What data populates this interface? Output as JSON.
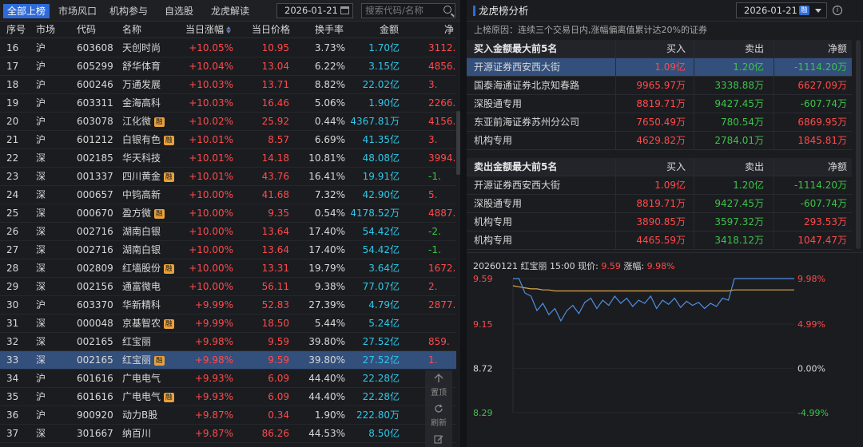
{
  "tabs": [
    "全部上榜",
    "市场风口",
    "机构参与",
    "自选股",
    "龙虎解读"
  ],
  "left_date": "2026-01-21",
  "search_placeholder": "搜索代码/名称",
  "columns": [
    "序号",
    "市场",
    "代码",
    "名称",
    "当日涨幅",
    "当日价格",
    "换手率",
    "金额",
    "净"
  ],
  "rows": [
    {
      "seq": "16",
      "mkt": "沪",
      "code": "603608",
      "name": "天创时尚",
      "rz": false,
      "chg": "+10.05%",
      "price": "10.95",
      "turn": "3.73%",
      "amt": "1.70亿",
      "net": "3112.",
      "neg": false
    },
    {
      "seq": "17",
      "mkt": "沪",
      "code": "605299",
      "name": "舒华体育",
      "rz": false,
      "chg": "+10.04%",
      "price": "13.04",
      "turn": "6.22%",
      "amt": "3.15亿",
      "net": "4856.",
      "neg": false
    },
    {
      "seq": "18",
      "mkt": "沪",
      "code": "600246",
      "name": "万通发展",
      "rz": false,
      "chg": "+10.03%",
      "price": "13.71",
      "turn": "8.82%",
      "amt": "22.02亿",
      "net": "3.",
      "neg": false
    },
    {
      "seq": "19",
      "mkt": "沪",
      "code": "603311",
      "name": "金海高科",
      "rz": false,
      "chg": "+10.03%",
      "price": "16.46",
      "turn": "5.06%",
      "amt": "1.90亿",
      "net": "2266.",
      "neg": false
    },
    {
      "seq": "20",
      "mkt": "沪",
      "code": "603078",
      "name": "江化微",
      "rz": true,
      "chg": "+10.02%",
      "price": "25.92",
      "turn": "0.44%",
      "amt": "4367.81万",
      "net": "4156.",
      "neg": false
    },
    {
      "seq": "21",
      "mkt": "沪",
      "code": "601212",
      "name": "白银有色",
      "rz": true,
      "chg": "+10.01%",
      "price": "8.57",
      "turn": "6.69%",
      "amt": "41.35亿",
      "net": "3.",
      "neg": false
    },
    {
      "seq": "22",
      "mkt": "深",
      "code": "002185",
      "name": "华天科技",
      "rz": false,
      "chg": "+10.01%",
      "price": "14.18",
      "turn": "10.81%",
      "amt": "48.08亿",
      "net": "3994.",
      "neg": false
    },
    {
      "seq": "23",
      "mkt": "深",
      "code": "001337",
      "name": "四川黄金",
      "rz": true,
      "chg": "+10.01%",
      "price": "43.76",
      "turn": "16.41%",
      "amt": "19.91亿",
      "net": "-1.",
      "neg": true
    },
    {
      "seq": "24",
      "mkt": "深",
      "code": "000657",
      "name": "中钨高新",
      "rz": false,
      "chg": "+10.00%",
      "price": "41.68",
      "turn": "7.32%",
      "amt": "42.90亿",
      "net": "5.",
      "neg": false
    },
    {
      "seq": "25",
      "mkt": "深",
      "code": "000670",
      "name": "盈方微",
      "rz": true,
      "chg": "+10.00%",
      "price": "9.35",
      "turn": "0.54%",
      "amt": "4178.52万",
      "net": "4887.",
      "neg": false
    },
    {
      "seq": "26",
      "mkt": "深",
      "code": "002716",
      "name": "湖南白银",
      "rz": false,
      "chg": "+10.00%",
      "price": "13.64",
      "turn": "17.40%",
      "amt": "54.42亿",
      "net": "-2.",
      "neg": true
    },
    {
      "seq": "27",
      "mkt": "深",
      "code": "002716",
      "name": "湖南白银",
      "rz": false,
      "chg": "+10.00%",
      "price": "13.64",
      "turn": "17.40%",
      "amt": "54.42亿",
      "net": "-1.",
      "neg": true
    },
    {
      "seq": "28",
      "mkt": "深",
      "code": "002809",
      "name": "红墙股份",
      "rz": true,
      "chg": "+10.00%",
      "price": "13.31",
      "turn": "19.79%",
      "amt": "3.64亿",
      "net": "1672.",
      "neg": false
    },
    {
      "seq": "29",
      "mkt": "深",
      "code": "002156",
      "name": "通富微电",
      "rz": false,
      "chg": "+10.00%",
      "price": "56.11",
      "turn": "9.38%",
      "amt": "77.07亿",
      "net": "2.",
      "neg": false
    },
    {
      "seq": "30",
      "mkt": "沪",
      "code": "603370",
      "name": "华新精科",
      "rz": false,
      "chg": "+9.99%",
      "price": "52.83",
      "turn": "27.39%",
      "amt": "4.79亿",
      "net": "2877.",
      "neg": false
    },
    {
      "seq": "31",
      "mkt": "深",
      "code": "000048",
      "name": "京基智农",
      "rz": true,
      "chg": "+9.99%",
      "price": "18.50",
      "turn": "5.44%",
      "amt": "5.24亿",
      "net": "",
      "neg": false
    },
    {
      "seq": "32",
      "mkt": "深",
      "code": "002165",
      "name": "红宝丽",
      "rz": false,
      "chg": "+9.98%",
      "price": "9.59",
      "turn": "39.80%",
      "amt": "27.52亿",
      "net": "859.",
      "neg": false
    },
    {
      "seq": "33",
      "mkt": "深",
      "code": "002165",
      "name": "红宝丽",
      "rz": true,
      "chg": "+9.98%",
      "price": "9.59",
      "turn": "39.80%",
      "amt": "27.52亿",
      "net": "1.",
      "neg": false
    },
    {
      "seq": "34",
      "mkt": "沪",
      "code": "601616",
      "name": "广电电气",
      "rz": false,
      "chg": "+9.93%",
      "price": "6.09",
      "turn": "44.40%",
      "amt": "22.28亿",
      "net": "",
      "neg": false
    },
    {
      "seq": "35",
      "mkt": "沪",
      "code": "601616",
      "name": "广电电气",
      "rz": true,
      "chg": "+9.93%",
      "price": "6.09",
      "turn": "44.40%",
      "amt": "22.28亿",
      "net": "",
      "neg": false
    },
    {
      "seq": "36",
      "mkt": "沪",
      "code": "900920",
      "name": "动力B股",
      "rz": false,
      "chg": "+9.87%",
      "price": "0.34",
      "turn": "1.90%",
      "amt": "222.80万",
      "net": "",
      "neg": false
    },
    {
      "seq": "37",
      "mkt": "深",
      "code": "301667",
      "name": "纳百川",
      "rz": false,
      "chg": "+9.87%",
      "price": "86.26",
      "turn": "44.53%",
      "amt": "8.50亿",
      "net": "",
      "neg": false
    }
  ],
  "rz_label": "融",
  "float_tools": {
    "top": "置顶",
    "refresh": "刷新"
  },
  "right": {
    "title": "龙虎榜分析",
    "date": "2026-01-21",
    "date_badge": "融",
    "reason": "上榜原因：连续三个交易日内,涨幅偏离值累计达20%的证券",
    "buy_table": {
      "title": "买入金额最大前5名",
      "headers": [
        "买入",
        "卖出",
        "净额"
      ],
      "rows": [
        {
          "name": "开源证券西安西大街",
          "buy": "1.09亿",
          "sell": "1.20亿",
          "net": "-1114.20万",
          "neg": true
        },
        {
          "name": "国泰海通证券北京知春路",
          "buy": "9965.97万",
          "sell": "3338.88万",
          "net": "6627.09万",
          "neg": false
        },
        {
          "name": "深股通专用",
          "buy": "8819.71万",
          "sell": "9427.45万",
          "net": "-607.74万",
          "neg": true
        },
        {
          "name": "东亚前海证券苏州分公司",
          "buy": "7650.49万",
          "sell": "780.54万",
          "net": "6869.95万",
          "neg": false
        },
        {
          "name": "机构专用",
          "buy": "4629.82万",
          "sell": "2784.01万",
          "net": "1845.81万",
          "neg": false
        }
      ]
    },
    "sell_table": {
      "title": "卖出金额最大前5名",
      "headers": [
        "买入",
        "卖出",
        "净额"
      ],
      "rows": [
        {
          "name": "开源证券西安西大街",
          "buy": "1.09亿",
          "sell": "1.20亿",
          "net": "-1114.20万",
          "neg": true
        },
        {
          "name": "深股通专用",
          "buy": "8819.71万",
          "sell": "9427.45万",
          "net": "-607.74万",
          "neg": true
        },
        {
          "name": "机构专用",
          "buy": "3890.85万",
          "sell": "3597.32万",
          "net": "293.53万",
          "neg": false
        },
        {
          "name": "机构专用",
          "buy": "4465.59万",
          "sell": "3418.12万",
          "net": "1047.47万",
          "neg": false
        }
      ]
    }
  },
  "chart_data": {
    "type": "line",
    "title": "20260121 红宝丽 15:00 现价: 9.59 涨幅: 9.98%",
    "title_parts": {
      "prefix": "20260121 红宝丽 15:00 现价:",
      "price": "9.59",
      "mid": "涨幅:",
      "pct": "9.98%"
    },
    "y_left_ticks": [
      "9.59",
      "9.15",
      "8.72",
      "8.29"
    ],
    "y_right_ticks": [
      "9.98%",
      "4.99%",
      "0.00%",
      "-4.99%"
    ],
    "ylim": [
      8.29,
      9.59
    ],
    "series": [
      {
        "color": "#4f8fe0",
        "values": [
          9.59,
          9.59,
          9.45,
          9.42,
          9.28,
          9.35,
          9.24,
          9.3,
          9.18,
          9.28,
          9.33,
          9.25,
          9.36,
          9.4,
          9.3,
          9.38,
          9.33,
          9.42,
          9.35,
          9.4,
          9.32,
          9.38,
          9.35,
          9.42,
          9.3,
          9.38,
          9.34,
          9.4,
          9.31,
          9.37,
          9.33,
          9.36,
          9.3,
          9.35,
          9.32,
          9.4,
          9.38,
          9.59,
          9.59,
          9.59,
          9.59,
          9.59,
          9.59,
          9.59,
          9.59,
          9.59,
          9.59,
          9.59
        ]
      },
      {
        "color": "#d9a84a",
        "values": [
          9.52,
          9.51,
          9.5,
          9.49,
          9.49,
          9.48,
          9.48,
          9.47,
          9.47,
          9.47,
          9.47,
          9.47,
          9.47,
          9.47,
          9.47,
          9.47,
          9.47,
          9.47,
          9.47,
          9.47,
          9.47,
          9.47,
          9.47,
          9.47,
          9.47,
          9.47,
          9.47,
          9.47,
          9.47,
          9.47,
          9.47,
          9.47,
          9.47,
          9.47,
          9.47,
          9.47,
          9.47,
          9.48,
          9.48,
          9.48,
          9.48,
          9.48,
          9.48,
          9.48,
          9.48,
          9.48,
          9.48,
          9.48
        ]
      }
    ]
  }
}
